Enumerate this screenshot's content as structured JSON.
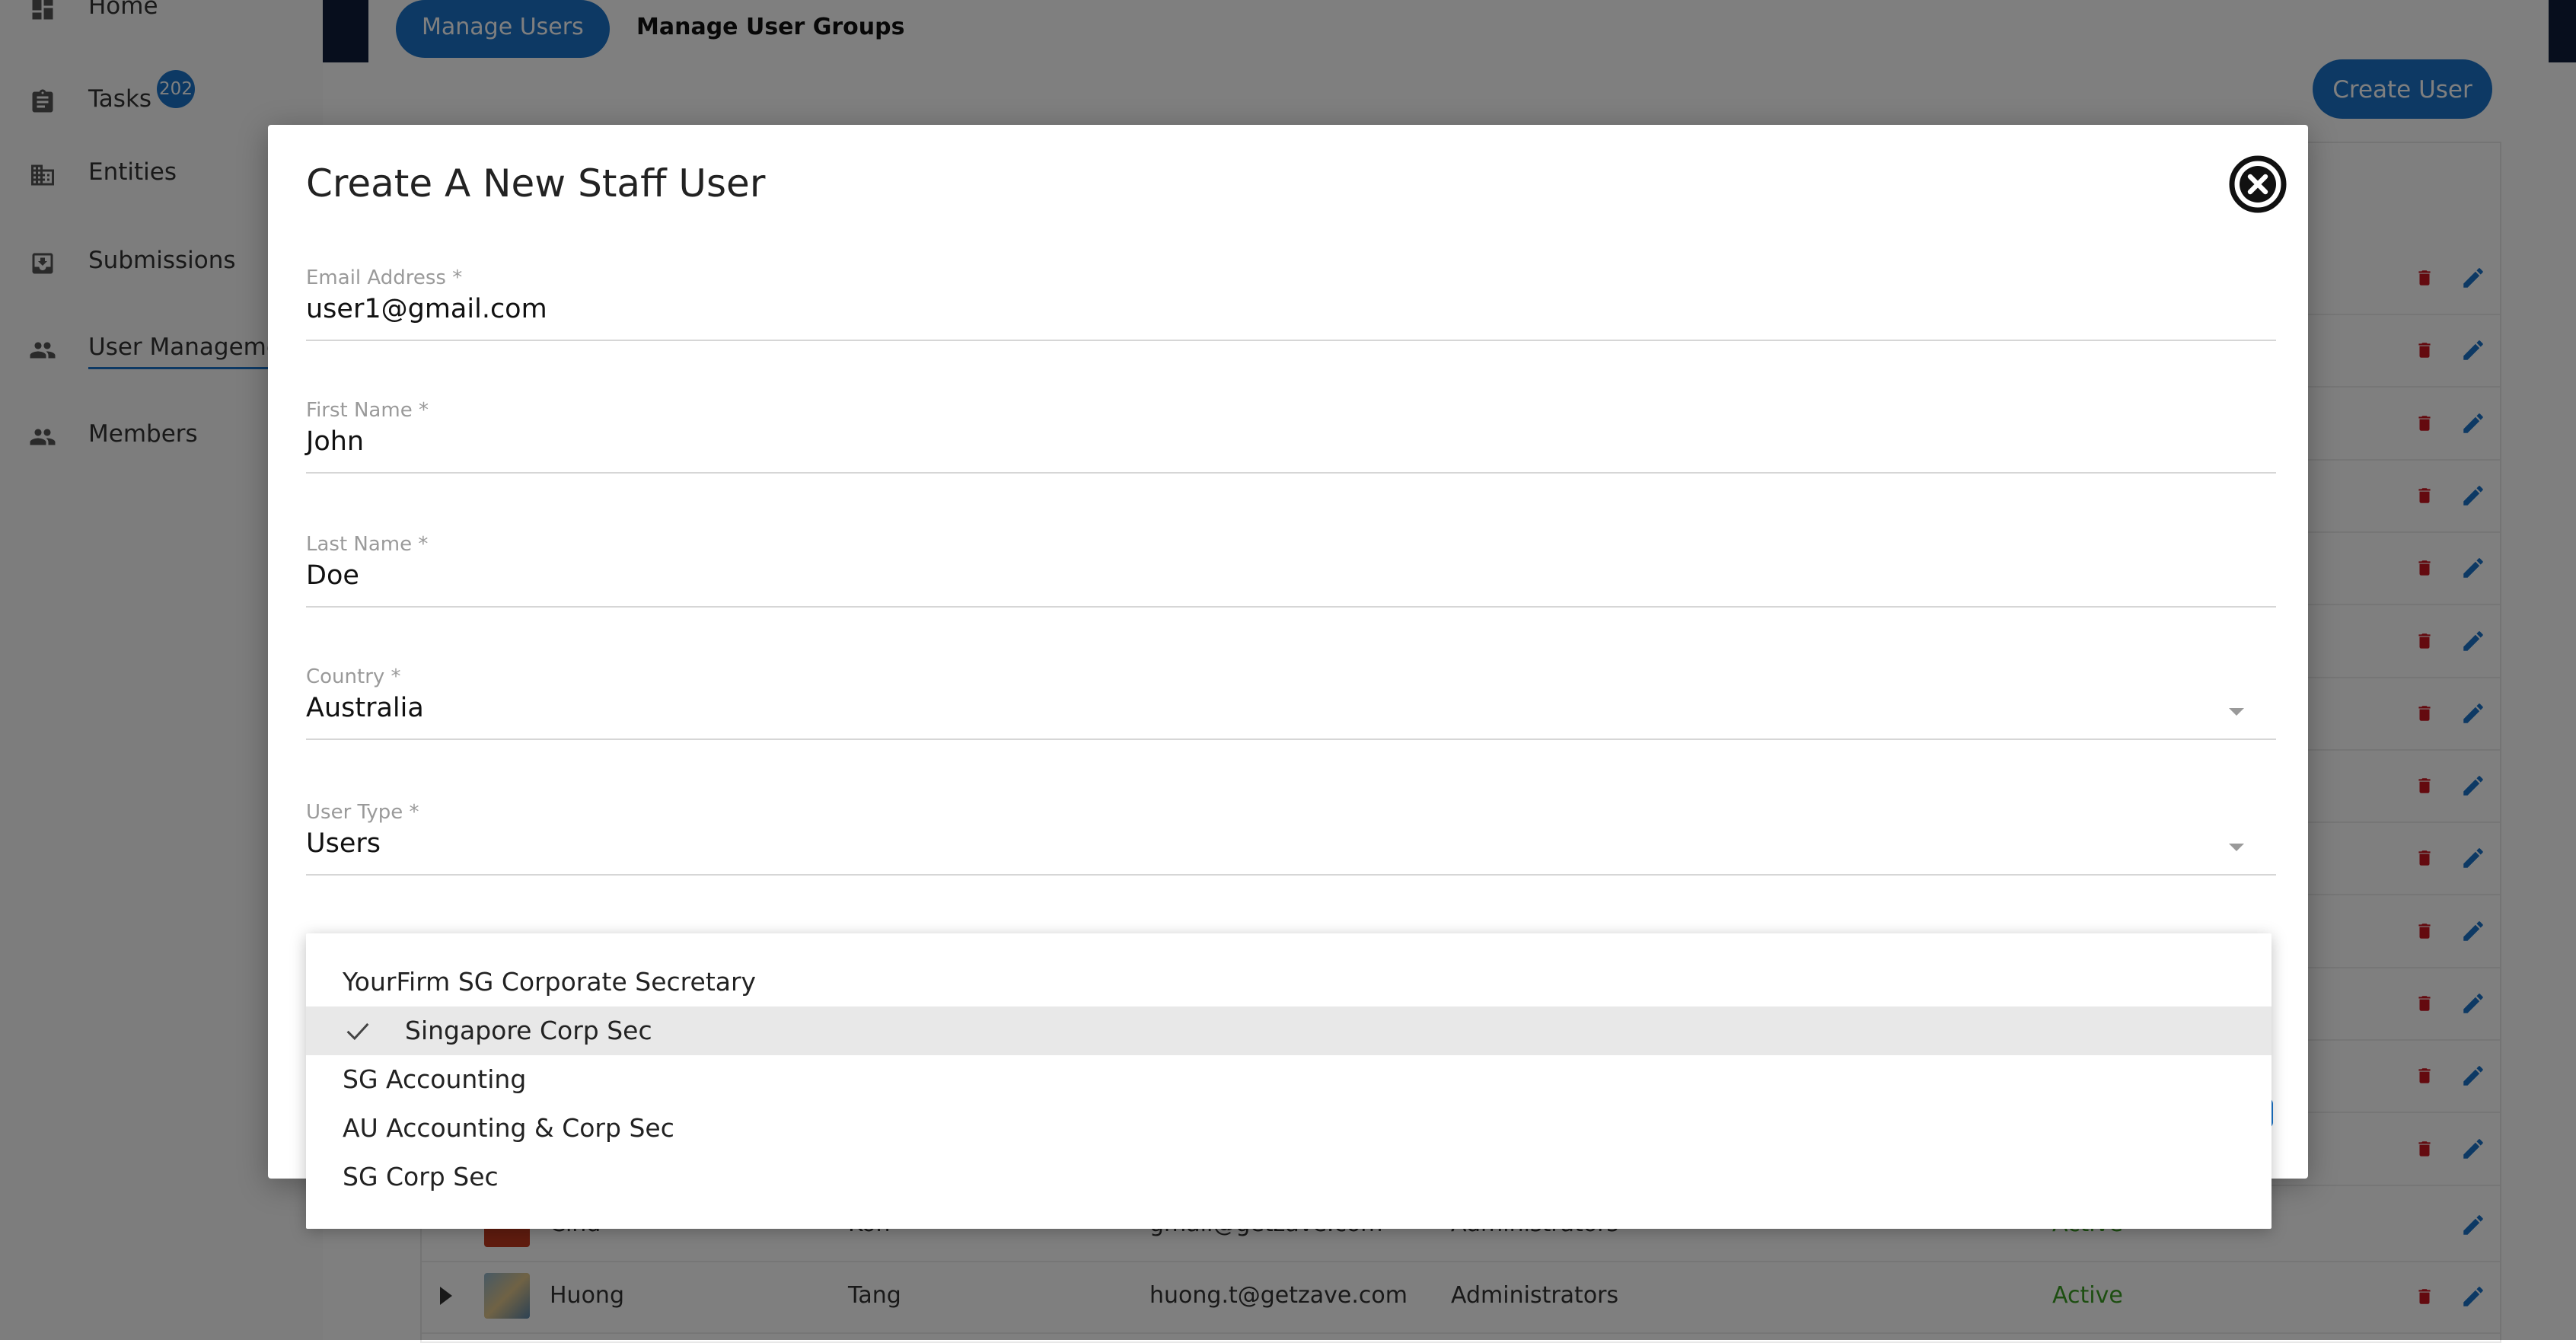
{
  "sidebar": {
    "items": [
      {
        "label": "Home",
        "icon": "dashboard-icon"
      },
      {
        "label": "Tasks",
        "icon": "clipboard-icon",
        "badge": "202"
      },
      {
        "label": "Entities",
        "icon": "building-icon"
      },
      {
        "label": "Submissions",
        "icon": "inbox-icon"
      },
      {
        "label": "User Manageme",
        "icon": "people-icon",
        "active": true
      },
      {
        "label": "Members",
        "icon": "people-icon"
      }
    ]
  },
  "header": {
    "tabs": [
      {
        "label": "Manage Users",
        "active": true
      },
      {
        "label": "Manage User Groups",
        "active": false
      }
    ],
    "create_user_label": "Create User"
  },
  "table": {
    "visible_rows": [
      {
        "first_name": "Cind",
        "last_name": "Koh",
        "email": "gmail@getzave.com",
        "group": "Administrators",
        "status": "Active"
      },
      {
        "first_name": "Huong",
        "last_name": "Tang",
        "email": "huong.t@getzave.com",
        "group": "Administrators",
        "status": "Active"
      }
    ]
  },
  "modal": {
    "title": "Create A New Staff User",
    "fields": {
      "email": {
        "label": "Email Address *",
        "value": "user1@gmail.com"
      },
      "first_name": {
        "label": "First Name *",
        "value": "John"
      },
      "last_name": {
        "label": "Last Name *",
        "value": "Doe"
      },
      "country": {
        "label": "Country *",
        "value": "Australia"
      },
      "user_type": {
        "label": "User Type *",
        "value": "Users"
      }
    }
  },
  "dropdown": {
    "options": [
      {
        "label": "YourFirm SG Corporate Secretary",
        "selected": false
      },
      {
        "label": "Singapore Corp Sec",
        "selected": true
      },
      {
        "label": "SG Accounting",
        "selected": false
      },
      {
        "label": "AU Accounting & Corp Sec",
        "selected": false
      },
      {
        "label": "SG Corp Sec",
        "selected": false
      }
    ]
  },
  "colors": {
    "accent": "#1a73c8",
    "danger": "#c9151e",
    "active_status": "#3a9d23",
    "overlay": "rgba(0,0,0,0.5)"
  }
}
